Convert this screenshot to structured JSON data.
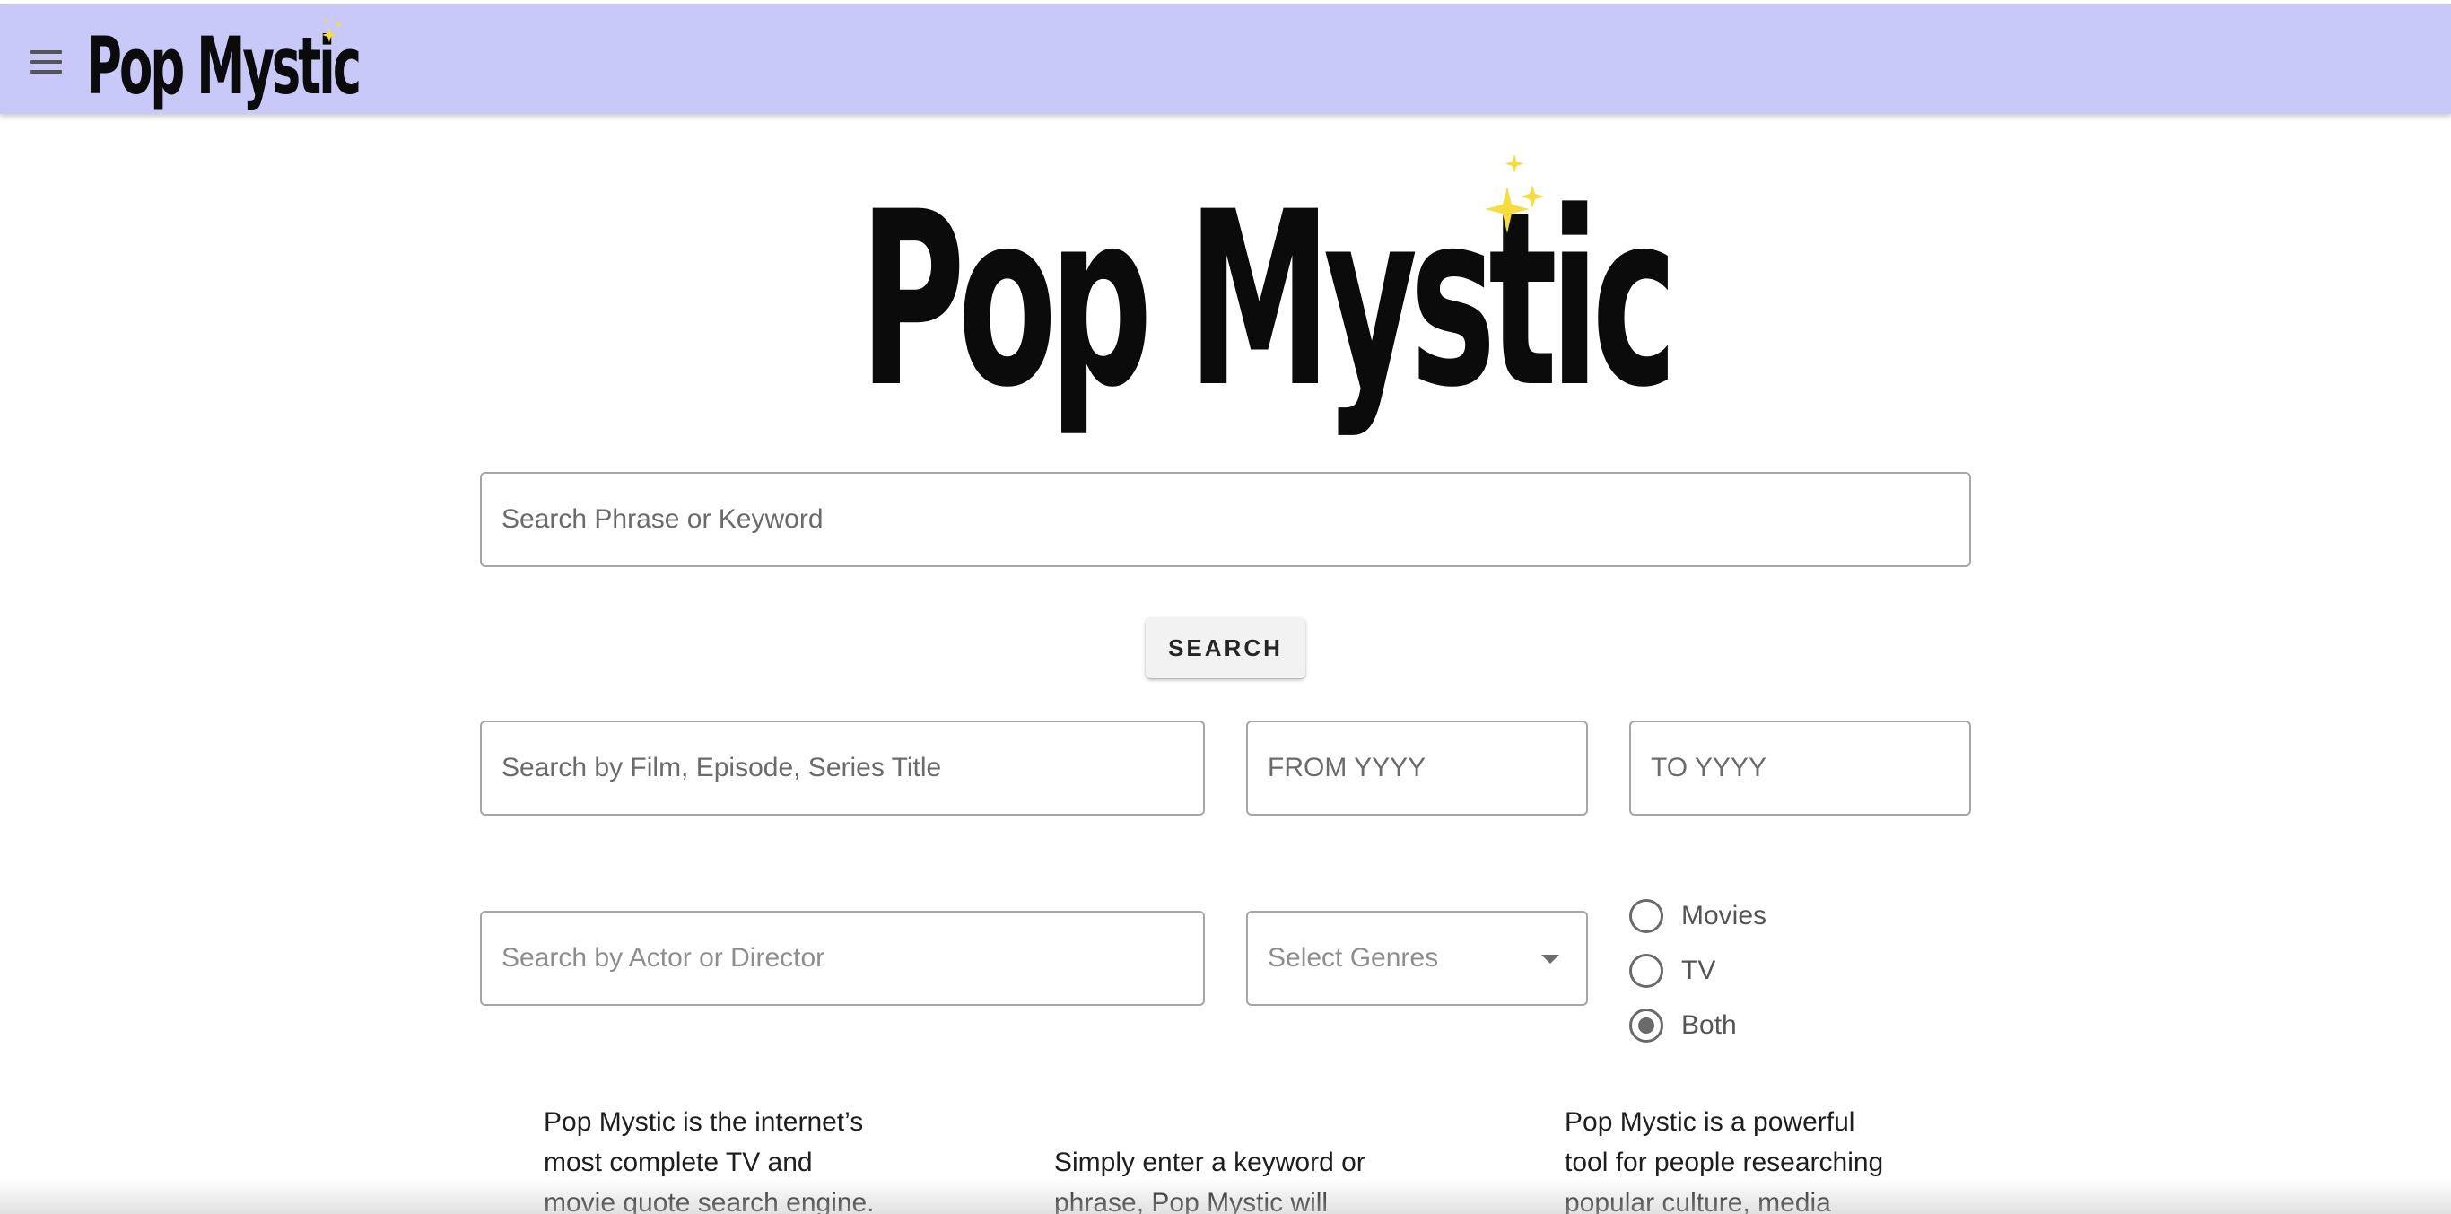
{
  "appbar": {
    "brand": "Pop Mystic",
    "background_color": "#c8c9f8",
    "menu_icon": "hamburger-menu-icon"
  },
  "hero": {
    "logo_text": "Pop Mystic",
    "sparkle_color": "#f5dd3c"
  },
  "search": {
    "placeholder": "Search Phrase or Keyword",
    "button_label": "SEARCH"
  },
  "filters": {
    "title_placeholder": "Search by Film, Episode, Series Title",
    "from_placeholder": "FROM YYYY",
    "to_placeholder": "TO YYYY",
    "actor_placeholder": "Search by Actor or Director",
    "genre_placeholder": "Select Genres",
    "media_types": [
      {
        "label": "Movies",
        "checked": false
      },
      {
        "label": "TV",
        "checked": false
      },
      {
        "label": "Both",
        "checked": true
      }
    ]
  },
  "info": {
    "col1": [
      "Pop Mystic is the internet’s",
      "most complete TV and",
      "movie quote search engine."
    ],
    "col2": [
      "Simply enter a keyword or",
      "phrase, Pop Mystic will"
    ],
    "col3": [
      "Pop Mystic is a powerful",
      "tool for people researching",
      "popular culture, media"
    ]
  }
}
